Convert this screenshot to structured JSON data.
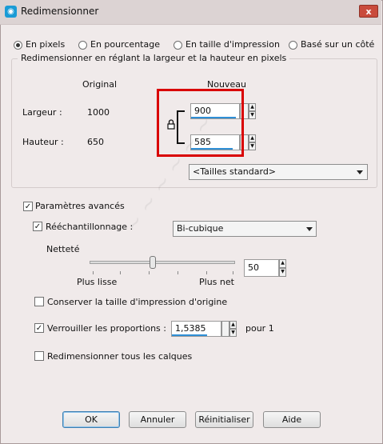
{
  "window": {
    "title": "Redimensionner",
    "close_glyph": "x"
  },
  "modes": [
    {
      "label": "En pixels",
      "selected": true
    },
    {
      "label": "En pourcentage",
      "selected": false
    },
    {
      "label": "En taille d'impression",
      "selected": false
    },
    {
      "label": "Basé sur un côté",
      "selected": false
    }
  ],
  "group": {
    "title": "Redimensionner en réglant la largeur et la hauteur en pixels",
    "col_original": "Original",
    "col_new": "Nouveau",
    "width_label": "Largeur :",
    "width_original": "1000",
    "width_new": "900",
    "height_label": "Hauteur :",
    "height_original": "650",
    "height_new": "585",
    "standard_sizes": "<Tailles standard>",
    "lock_icon": "lock-icon"
  },
  "advanced": {
    "label": "Paramètres avancés",
    "checked": true,
    "resample_label": "Rééchantillonnage :",
    "resample_checked": true,
    "resample_method": "Bi-cubique",
    "sharpness_label": "Netteté",
    "sharpness_value": "50",
    "slider_min_label": "Plus lisse",
    "slider_max_label": "Plus net",
    "keep_print_size_label": "Conserver la taille d'impression d'origine",
    "keep_print_size_checked": false,
    "lock_ratio_label": "Verrouiller les proportions :",
    "lock_ratio_checked": true,
    "ratio_value": "1,5385",
    "ratio_suffix": "pour 1",
    "resize_all_layers_label": "Redimensionner tous les calques",
    "resize_all_layers_checked": false
  },
  "buttons": {
    "ok": "OK",
    "cancel": "Annuler",
    "reset": "Réinitialiser",
    "help": "Aide"
  },
  "colors": {
    "accent": "#2f8fd6",
    "highlight_box": "#d90000"
  }
}
